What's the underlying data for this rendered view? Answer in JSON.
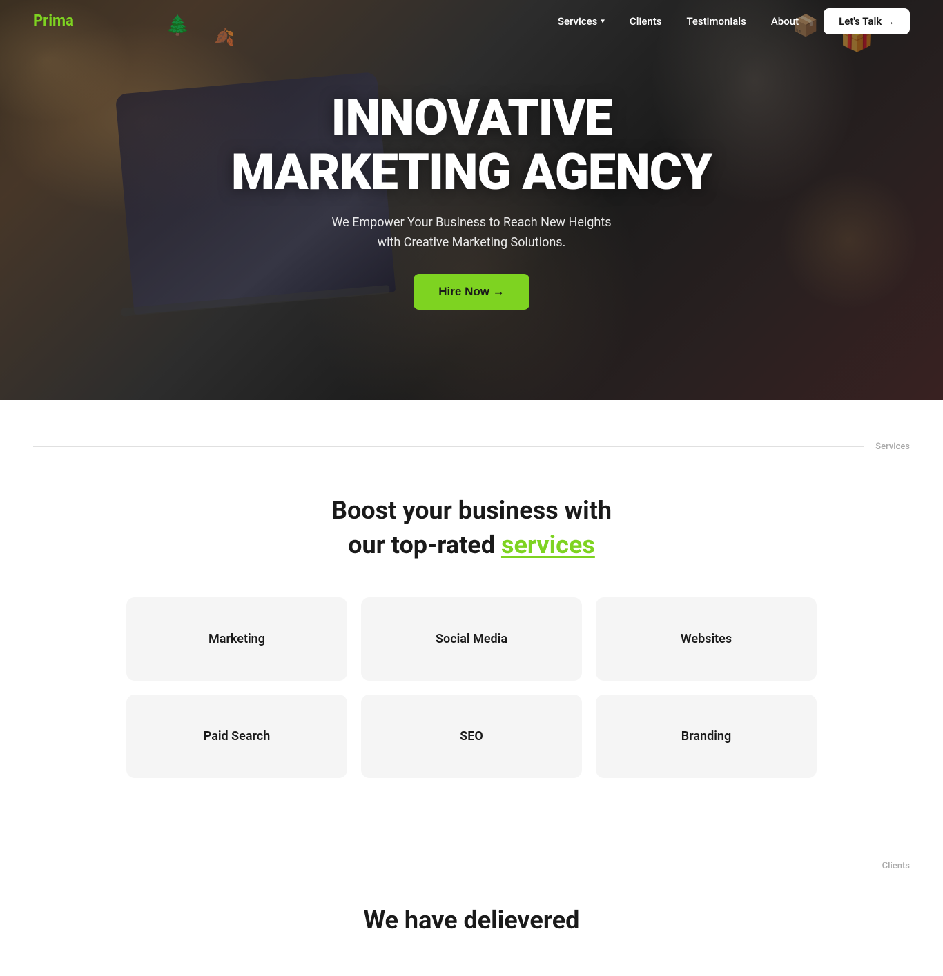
{
  "brand": {
    "logo": "Prima"
  },
  "navbar": {
    "links": [
      {
        "label": "Services",
        "hasDropdown": true
      },
      {
        "label": "Clients",
        "hasDropdown": false
      },
      {
        "label": "Testimonials",
        "hasDropdown": false
      },
      {
        "label": "About",
        "hasDropdown": false
      }
    ],
    "cta": "Let's Talk →"
  },
  "hero": {
    "title_line1": "INNOVATIVE",
    "title_line2": "MARKETING AGENCY",
    "subtitle": "We Empower Your Business to Reach New Heights with Creative Marketing Solutions.",
    "cta": "Hire Now →"
  },
  "services_section": {
    "divider_label": "Services",
    "heading_line1": "Boost your business with",
    "heading_line2_plain": "our top-rated ",
    "heading_line2_highlight": "services",
    "cards": [
      {
        "label": "Marketing"
      },
      {
        "label": "Social Media"
      },
      {
        "label": "Websites"
      },
      {
        "label": "Paid Search"
      },
      {
        "label": "SEO"
      },
      {
        "label": "Branding"
      }
    ]
  },
  "clients_section": {
    "divider_label": "Clients",
    "heading": "We have delievered"
  }
}
